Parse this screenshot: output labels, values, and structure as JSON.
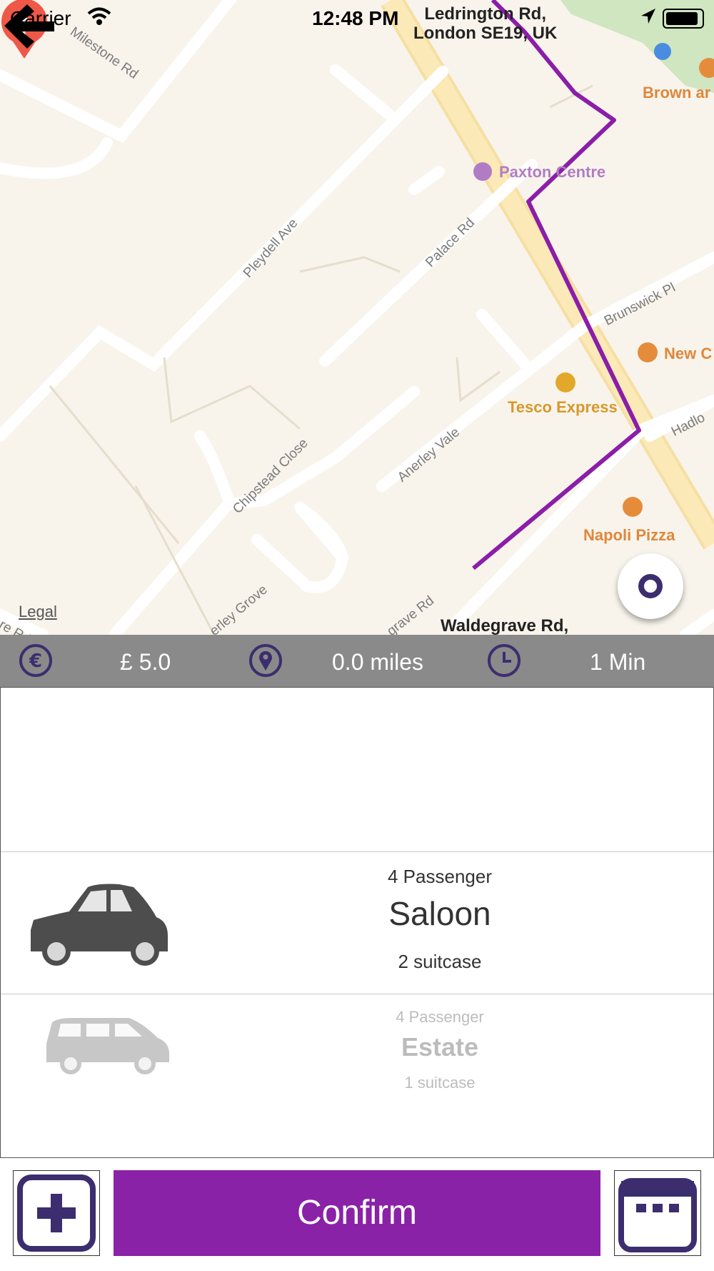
{
  "status_bar": {
    "carrier": "Carrier",
    "time": "12:48 PM"
  },
  "map": {
    "legal": "Legal",
    "top_address": [
      "Ledrington Rd,",
      "London SE19, UK"
    ],
    "bottom_address": "Waldegrave Rd,",
    "places": [
      "Paxton Centre",
      "Tesco Express",
      "Napoli Pizza",
      "New C",
      "Brown ar"
    ],
    "roads": [
      "Milestone Rd",
      "Pleydell Ave",
      "Palace Rd",
      "Brunswick Pl",
      "Chipstead Close",
      "Anerley Vale",
      "Hadlo",
      "erley Grove",
      "grave Rd",
      "re Rd"
    ],
    "colors": {
      "route": "#8b1ea8",
      "pin": "#ef5847",
      "poi_orange": "#dd8a36",
      "poi_purple": "#b27cc4"
    }
  },
  "info_bar": {
    "fare": "£ 5.0",
    "distance": "0.0 miles",
    "duration": "1 Min",
    "icons": [
      "euro-icon",
      "location-pin-icon",
      "clock-icon"
    ]
  },
  "vehicles": [
    {
      "passengers": "4 Passenger",
      "name": "Saloon",
      "luggage": "2 suitcase",
      "icon": "saloon-car-icon"
    },
    {
      "passengers": "4 Passenger",
      "name": "Estate",
      "luggage": "1 suitcase",
      "icon": "estate-car-icon"
    }
  ],
  "actions": {
    "confirm_label": "Confirm",
    "add_icon": "plus-square-icon",
    "schedule_icon": "calendar-icon"
  },
  "accent_color": "#8a22a8"
}
